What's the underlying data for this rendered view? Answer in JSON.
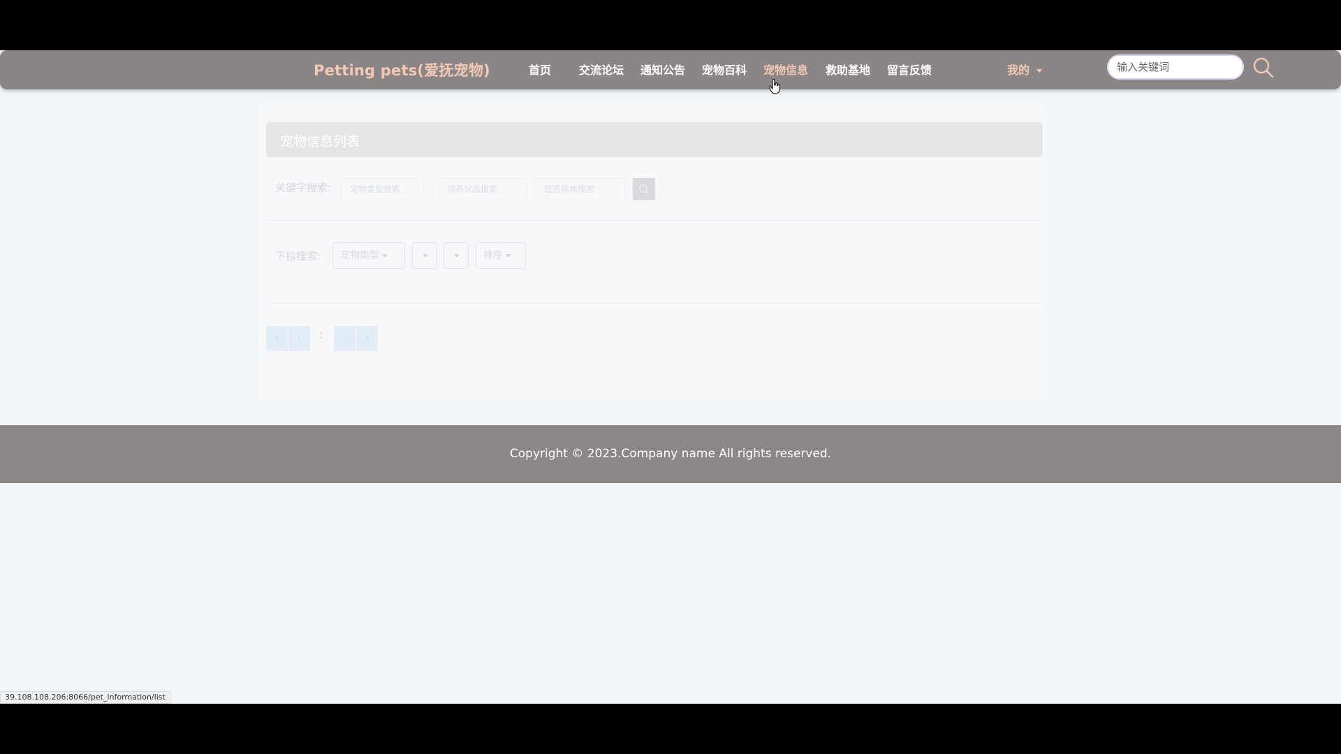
{
  "header": {
    "brand": "Petting pets(爱抚宠物)",
    "nav": [
      {
        "label": "首页"
      },
      {
        "label": "交流论坛"
      },
      {
        "label": "通知公告"
      },
      {
        "label": "宠物百科"
      },
      {
        "label": "宠物信息",
        "active": true
      },
      {
        "label": "救助基地"
      },
      {
        "label": "留言反馈"
      }
    ],
    "user_menu": "我的",
    "search_placeholder": "输入关键词",
    "search_icon": "search-icon"
  },
  "main": {
    "list_title": "宠物信息列表",
    "keyword_label": "关键字搜索:",
    "keyword_inputs": [
      {
        "placeholder": "宠物类型搜索"
      },
      {
        "placeholder": "领养状态搜索"
      },
      {
        "placeholder": "是否疾病搜索"
      }
    ],
    "dropdown_label": "下拉搜索:",
    "dropdowns": [
      {
        "label": "宠物类型"
      },
      {
        "label": ""
      },
      {
        "label": ""
      },
      {
        "label": "排序"
      }
    ],
    "pagination": {
      "current_page": "1"
    }
  },
  "footer": {
    "copyright": "Copyright © 2023.Company name All rights reserved."
  },
  "status_bar": {
    "url": "39.108.108.206:8066/pet_information/list"
  },
  "colors": {
    "navbar": "#8c8585",
    "brand": "#f2c9b6",
    "footer": "#8c8787",
    "page_bg": "#f3f6f8"
  }
}
